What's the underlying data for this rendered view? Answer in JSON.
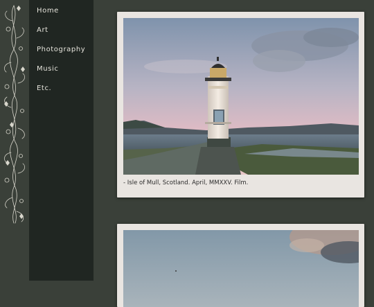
{
  "nav": {
    "items": [
      {
        "label": "Home"
      },
      {
        "label": "Art"
      },
      {
        "label": "Photography"
      },
      {
        "label": "Music"
      },
      {
        "label": "Etc."
      }
    ]
  },
  "posts": [
    {
      "caption": "- Isle of Mull, Scotland. April, MMXXV. Film.",
      "photo_icon": "lighthouse-photo"
    },
    {
      "caption": "",
      "photo_icon": "sky-photo"
    }
  ],
  "colors": {
    "page_background": "#3a4039",
    "sidebar_background": "#202622",
    "nav_text": "#e6e4dc",
    "polaroid_frame": "#e9e5e1"
  }
}
